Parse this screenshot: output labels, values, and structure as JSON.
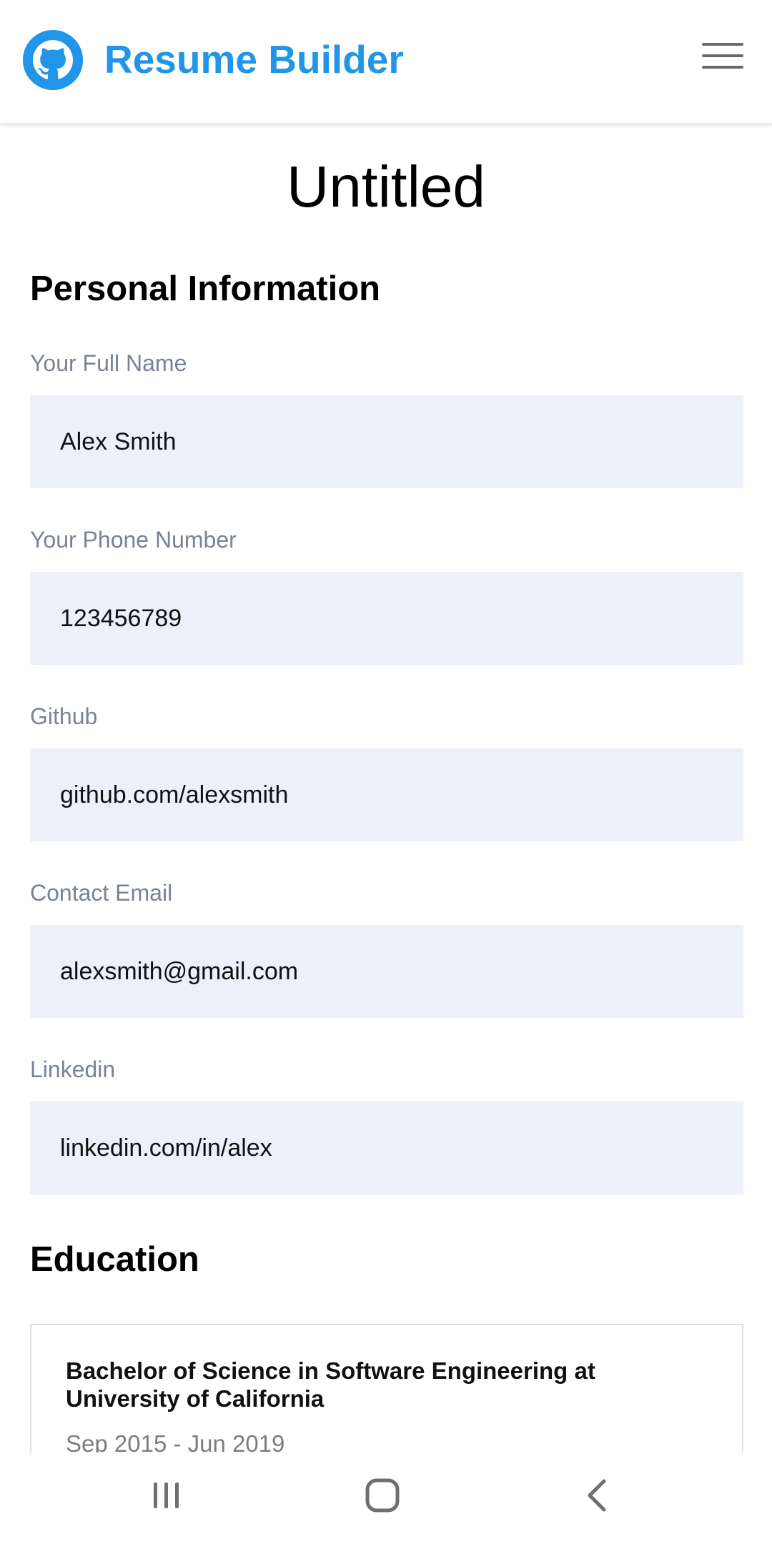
{
  "header": {
    "app_title": "Resume Builder",
    "logo_icon": "github-icon",
    "menu_icon": "hamburger-menu-icon",
    "brand_color": "#2196e8"
  },
  "resume": {
    "title": "Untitled"
  },
  "personal": {
    "section_title": "Personal Information",
    "fields": [
      {
        "label": "Your Full Name",
        "value": "Alex Smith"
      },
      {
        "label": "Your Phone Number",
        "value": "123456789"
      },
      {
        "label": "Github",
        "value": "github.com/alexsmith"
      },
      {
        "label": "Contact Email",
        "value": "alexsmith@gmail.com"
      },
      {
        "label": "Linkedin",
        "value": "linkedin.com/in/alex"
      }
    ]
  },
  "education": {
    "section_title": "Education",
    "items": [
      {
        "degree": "Bachelor of Science in Software Engineering at University of California",
        "dates": "Sep 2015 - Jun 2019"
      }
    ]
  },
  "system_nav": {
    "recents_icon": "recents-icon",
    "home_icon": "home-icon",
    "back_icon": "back-icon"
  },
  "colors": {
    "input_background": "#edf0f8",
    "label_text": "#7a8394"
  }
}
